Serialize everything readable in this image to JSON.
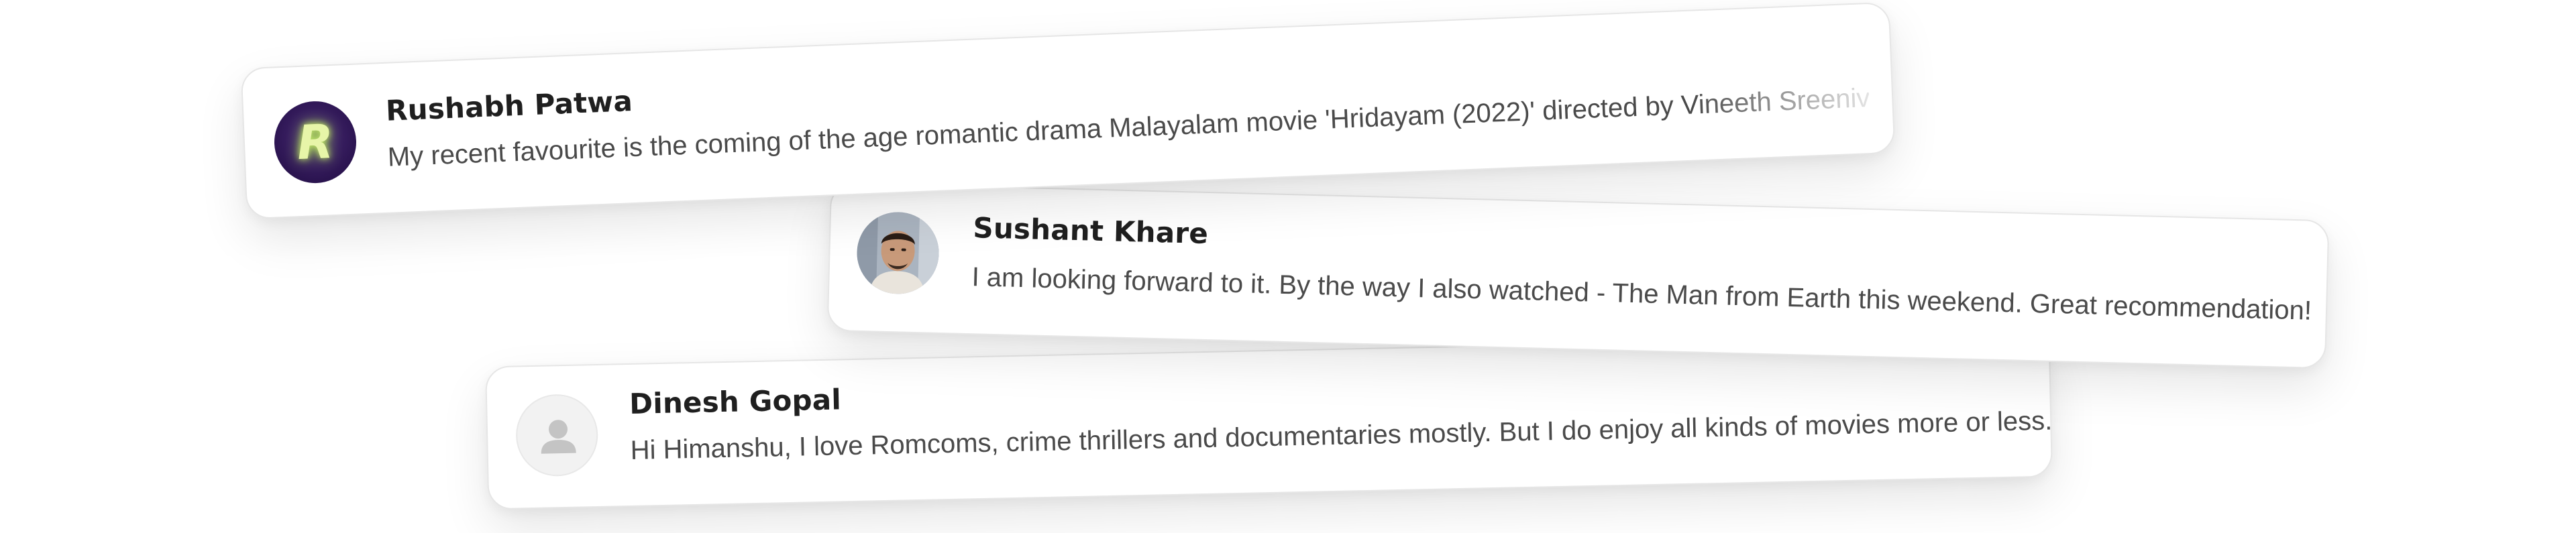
{
  "messages": [
    {
      "name": "Rushabh Patwa",
      "avatar_letter": "R",
      "avatar_icon": "letter-avatar-icon",
      "text": "My recent favourite is the coming of the age romantic drama Malayalam movie 'Hridayam (2022)' directed by Vineeth Sreenivasan"
    },
    {
      "name": "Sushant Khare",
      "avatar_icon": "profile-photo-icon",
      "text": "I am looking forward to it. By the way I also watched - The Man from Earth this weekend. Great recommendation!"
    },
    {
      "name": "Dinesh Gopal",
      "avatar_icon": "default-user-icon",
      "text": "Hi Himanshu, I love Romcoms, crime thrillers and documentaries mostly. But I do enjoy all kinds of movies more or less."
    }
  ]
}
